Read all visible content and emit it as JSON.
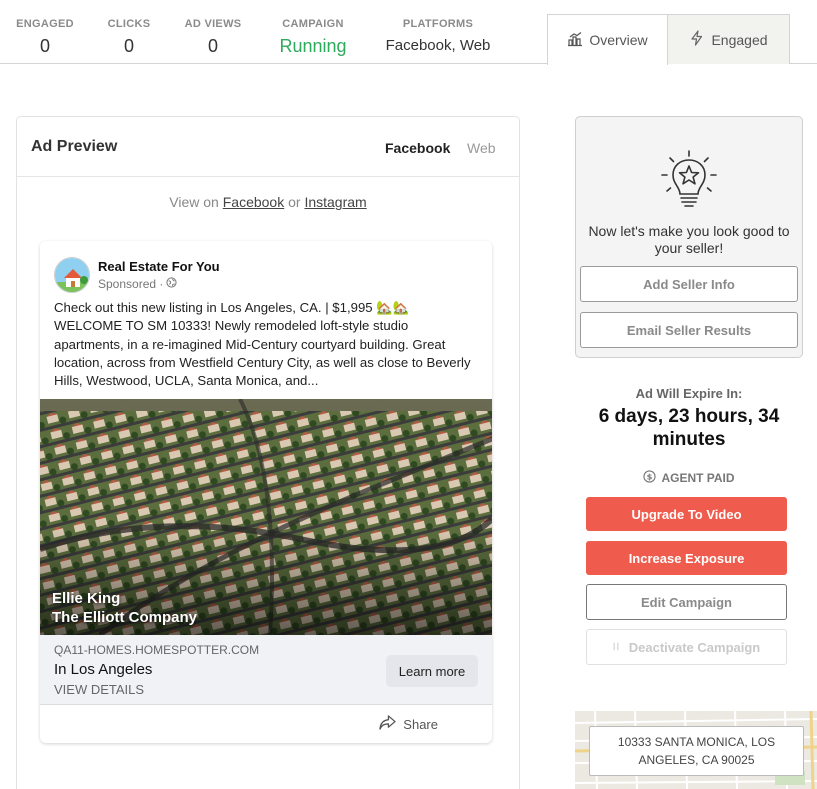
{
  "stats": {
    "engaged": {
      "label": "ENGAGED",
      "value": "0"
    },
    "clicks": {
      "label": "CLICKS",
      "value": "0"
    },
    "ad_views": {
      "label": "AD VIEWS",
      "value": "0"
    },
    "campaign": {
      "label": "CAMPAIGN",
      "value": "Running"
    },
    "platforms": {
      "label": "PLATFORMS",
      "value": "Facebook, Web"
    }
  },
  "tabs": {
    "overview": {
      "label": "Overview",
      "icon": "chart-icon"
    },
    "engaged": {
      "label": "Engaged",
      "icon": "lightning-icon"
    }
  },
  "preview": {
    "title": "Ad Preview",
    "platform_tabs": {
      "facebook": "Facebook",
      "web": "Web"
    },
    "view_on": {
      "prefix": "View on",
      "link1": "Facebook",
      "connector": "or",
      "link2": "Instagram"
    },
    "post": {
      "page_name": "Real Estate For You",
      "sponsored": "Sponsored ·",
      "body": "Check out this new listing in Los Angeles, CA. | $1,995 🏡🏡 WELCOME TO SM 10333! Newly remodeled loft-style studio apartments, in a re-imagined Mid-Century courtyard building. Great location, across from Westfield Century City, as well as close to Beverly Hills, Westwood, UCLA, Santa Monica, and...",
      "image_caption_line1": "Ellie King",
      "image_caption_line2": "The Elliott Company",
      "link_domain": "QA11-HOMES.HOMESPOTTER.COM",
      "link_headline": "In Los Angeles",
      "link_sub": "VIEW DETAILS",
      "cta": "Learn more",
      "share": "Share"
    }
  },
  "seller": {
    "message": "Now let's make you look good to your seller!",
    "add_info": "Add Seller Info",
    "email_results": "Email Seller Results"
  },
  "expiry": {
    "label": "Ad Will Expire In:",
    "value": "6 days, 23 hours, 34 minutes"
  },
  "agent_paid": "AGENT PAID",
  "actions": {
    "upgrade": "Upgrade To Video",
    "increase": "Increase Exposure",
    "edit": "Edit Campaign",
    "deactivate": "Deactivate Campaign"
  },
  "map": {
    "address_line1": "10333 SANTA MONICA, LOS",
    "address_line2": "ANGELES, CA 90025"
  },
  "colors": {
    "running": "#2eaa5c",
    "primary_action": "#ef5b4c"
  }
}
